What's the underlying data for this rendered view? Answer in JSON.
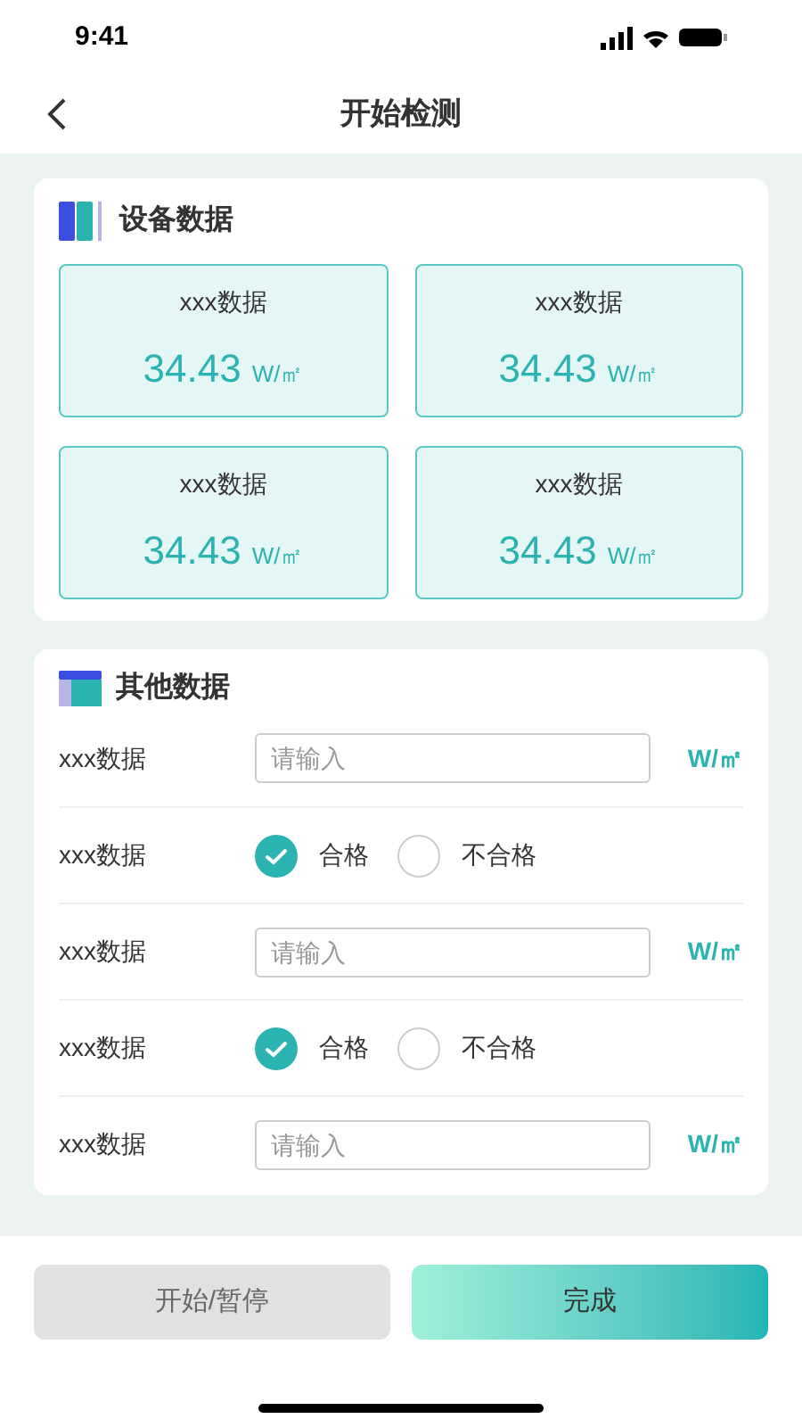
{
  "status_bar": {
    "time": "9:41"
  },
  "header": {
    "title": "开始检测"
  },
  "device_section": {
    "title": "设备数据",
    "tiles": [
      {
        "label": "xxx数据",
        "value": "34.43",
        "unit": "W/㎡"
      },
      {
        "label": "xxx数据",
        "value": "34.43",
        "unit": "W/㎡"
      },
      {
        "label": "xxx数据",
        "value": "34.43",
        "unit": "W/㎡"
      },
      {
        "label": "xxx数据",
        "value": "34.43",
        "unit": "W/㎡"
      }
    ]
  },
  "other_section": {
    "title": "其他数据",
    "rows": [
      {
        "kind": "input",
        "label": "xxx数据",
        "placeholder": "请输入",
        "unit": "W/㎡"
      },
      {
        "kind": "radio",
        "label": "xxx数据",
        "options": [
          {
            "label": "合格",
            "selected": true
          },
          {
            "label": "不合格",
            "selected": false
          }
        ]
      },
      {
        "kind": "input",
        "label": "xxx数据",
        "placeholder": "请输入",
        "unit": "W/㎡"
      },
      {
        "kind": "radio",
        "label": "xxx数据",
        "options": [
          {
            "label": "合格",
            "selected": true
          },
          {
            "label": "不合格",
            "selected": false
          }
        ]
      },
      {
        "kind": "input",
        "label": "xxx数据",
        "placeholder": "请输入",
        "unit": "W/㎡"
      }
    ]
  },
  "buttons": [
    {
      "kind": "secondary",
      "label": "开始/暂停"
    },
    {
      "kind": "primary",
      "label": "完成"
    }
  ]
}
